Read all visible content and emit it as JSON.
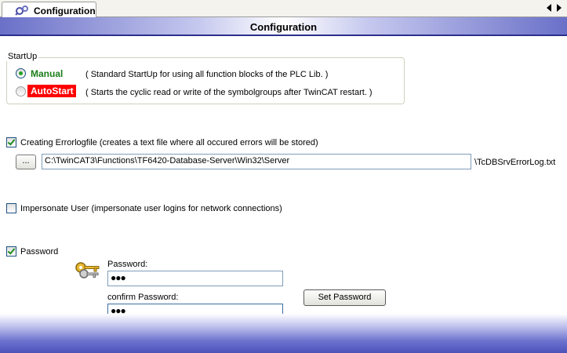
{
  "tab": {
    "label": "Configuration",
    "icon": "gear-icon"
  },
  "header": {
    "title": "Configuration"
  },
  "startup": {
    "legend": "StartUp",
    "manual": {
      "label": "Manual",
      "description": "( Standard StartUp for using all function blocks of the PLC Lib. )",
      "selected": true
    },
    "autostart": {
      "label": "AutoStart",
      "description": "( Starts the cyclic read or write of the symbolgroups after TwinCAT restart. )",
      "selected": false
    }
  },
  "errorlog": {
    "checked": true,
    "label": "Creating Errorlogfile (creates a text file where all occured errors will be stored)",
    "browse_label": "...",
    "path_value": "C:\\TwinCAT3\\Functions\\TF6420-Database-Server\\Win32\\Server",
    "path_suffix": "\\TcDBSrvErrorLog.txt"
  },
  "impersonate": {
    "checked": false,
    "label": "Impersonate User (impersonate user logins for network connections)"
  },
  "password": {
    "checked": true,
    "label": "Password",
    "password_label": "Password:",
    "password_value": "●●●",
    "confirm_label": "confirm Password:",
    "confirm_value": "●●●",
    "set_button_label": "Set Password"
  },
  "colors": {
    "manual_text": "#1a7d1a",
    "autostart_bg": "#ff0000",
    "header_accent": "#2c2f8c"
  }
}
